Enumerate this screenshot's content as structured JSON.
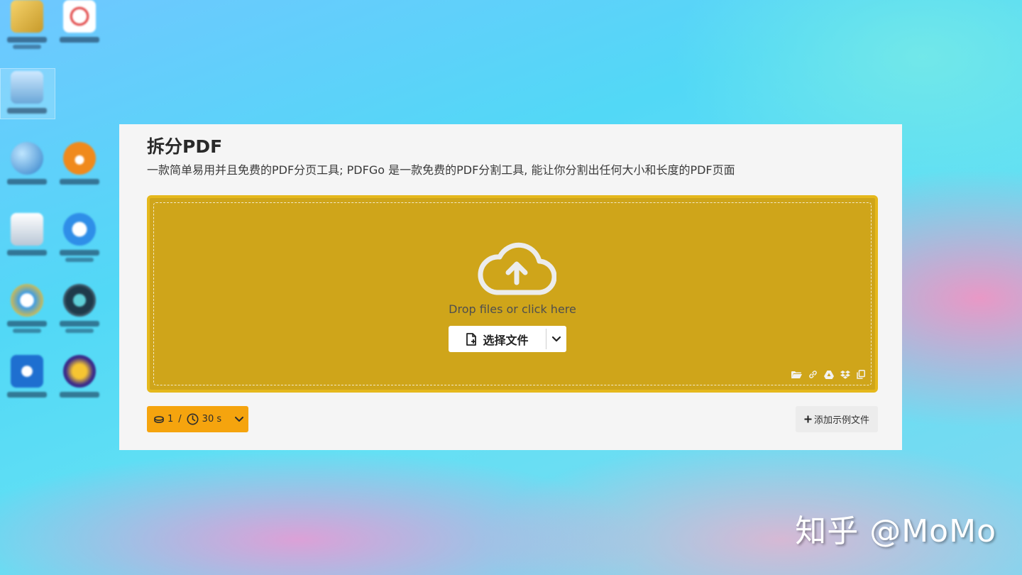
{
  "page": {
    "title": "拆分PDF",
    "subtitle": "一款简单易用并且免费的PDF分页工具; PDFGo 是一款免费的PDF分割工具, 能让你分割出任何大小和长度的PDF页面"
  },
  "dropzone": {
    "prompt": "Drop files or click here",
    "select_label": "选择文件",
    "sources": [
      "folder-icon",
      "link-icon",
      "google-drive-icon",
      "dropbox-icon",
      "clipboard-icon"
    ]
  },
  "credits": {
    "count": "1",
    "separator": "/",
    "duration": "30 s"
  },
  "sample": {
    "label": "添加示例文件"
  },
  "watermark": {
    "text": "知乎 @MoMo"
  },
  "colors": {
    "dropzone_fill": "#cfa51a",
    "dropzone_border": "#e5b81c",
    "credit_button": "#f5a40e",
    "panel": "#f5f5f5"
  }
}
